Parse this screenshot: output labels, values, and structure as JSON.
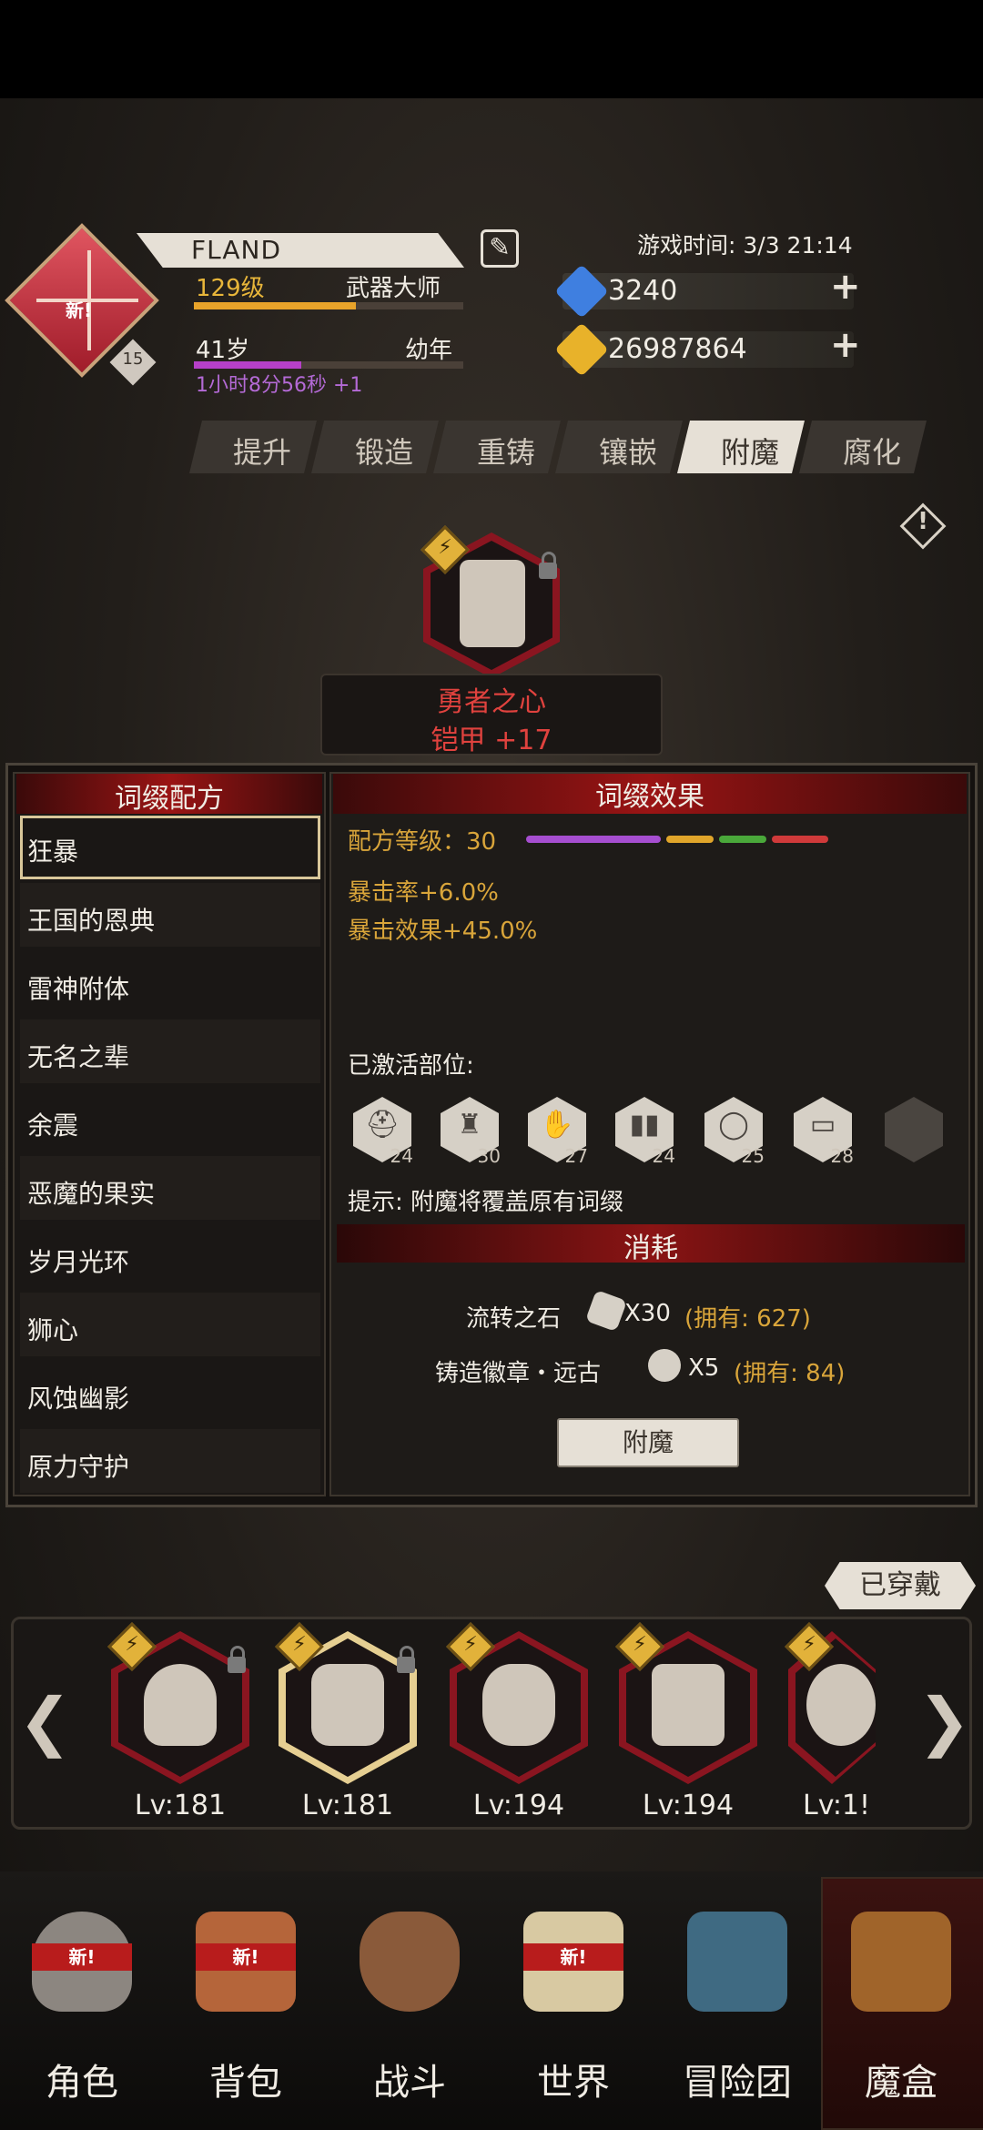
{
  "header": {
    "player_name": "FLAND",
    "edit_icon": "edit-icon",
    "game_time": "游戏时间: 3/3 21:14",
    "rank_badge": "新!",
    "rank_level": "15",
    "level_label": "129级",
    "title": "武器大师",
    "level_progress": 0.6,
    "age_label": "41岁",
    "age_stage": "幼年",
    "age_progress": 0.4,
    "age_timer": "1小时8分56秒 +1"
  },
  "currency": {
    "gems": "3240",
    "gold": "26987864",
    "gem_color": "#3f7fe0",
    "gold_color": "#e8b22a"
  },
  "tabs": [
    {
      "label": "提升"
    },
    {
      "label": "锻造"
    },
    {
      "label": "重铸"
    },
    {
      "label": "镶嵌"
    },
    {
      "label": "附魔"
    },
    {
      "label": "腐化"
    }
  ],
  "active_tab": "附魔",
  "featured": {
    "name": "勇者之心",
    "sub": "铠甲 +17"
  },
  "recipes": {
    "title": "词缀配方",
    "items": [
      {
        "label": "狂暴"
      },
      {
        "label": "王国的恩典"
      },
      {
        "label": "雷神附体"
      },
      {
        "label": "无名之辈"
      },
      {
        "label": "余震"
      },
      {
        "label": "恶魔的果实"
      },
      {
        "label": "岁月光环"
      },
      {
        "label": "狮心"
      },
      {
        "label": "风蚀幽影"
      },
      {
        "label": "原力守护"
      }
    ],
    "selected": "狂暴"
  },
  "effects": {
    "title": "词缀效果",
    "recipe_level": "配方等级：30",
    "level_colors": [
      "#a64ed0",
      "#e0a52a",
      "#4aa83a",
      "#d03a3a"
    ],
    "stat1": "暴击率+6.0%",
    "stat2": "暴击效果+45.0%",
    "activated_label": "已激活部位:",
    "slots": [
      {
        "icon": "helmet-icon",
        "num": "24"
      },
      {
        "icon": "armor-icon",
        "num": "30"
      },
      {
        "icon": "glove-icon",
        "num": "27"
      },
      {
        "icon": "boots-icon",
        "num": "24"
      },
      {
        "icon": "ring-icon",
        "num": "25"
      },
      {
        "icon": "belt-icon",
        "num": "28"
      },
      {
        "icon": "cape-icon",
        "num": ""
      }
    ],
    "hint": "提示: 附魔将覆盖原有词缀"
  },
  "cost": {
    "title": "消耗",
    "item1_name": "流转之石",
    "item1_qty": "X30",
    "item1_owned": "(拥有: 627)",
    "item2_name": "铸造徽章・远古",
    "item2_qty": "X5",
    "item2_owned": "(拥有: 84)",
    "button": "附魔"
  },
  "equipped_label": "已穿戴",
  "carousel": {
    "items": [
      {
        "lv": "Lv:181"
      },
      {
        "lv": "Lv:181"
      },
      {
        "lv": "Lv:194"
      },
      {
        "lv": "Lv:194"
      },
      {
        "lv": "Lv:1!"
      }
    ]
  },
  "nav": {
    "items": [
      {
        "label": "角色",
        "new": "新!"
      },
      {
        "label": "背包",
        "new": "新!"
      },
      {
        "label": "战斗",
        "new": ""
      },
      {
        "label": "世界",
        "new": "新!"
      },
      {
        "label": "冒险团",
        "new": ""
      },
      {
        "label": "魔盒",
        "new": ""
      }
    ],
    "active": "魔盒"
  }
}
